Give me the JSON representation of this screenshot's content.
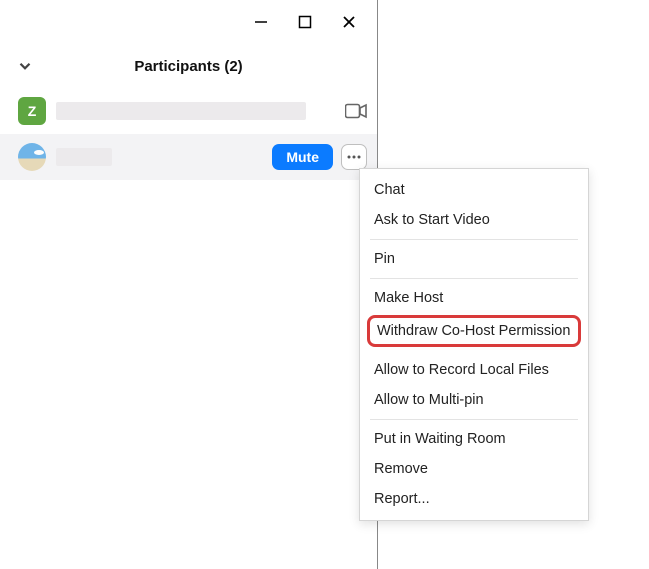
{
  "header": {
    "title": "Participants (2)"
  },
  "participants": [
    {
      "initial": "Z"
    },
    {}
  ],
  "actions": {
    "mute": "Mute"
  },
  "menu": {
    "chat": "Chat",
    "ask_video": "Ask to Start Video",
    "pin": "Pin",
    "make_host": "Make Host",
    "withdraw_cohost": "Withdraw Co-Host Permission",
    "allow_record": "Allow to Record Local Files",
    "allow_multipin": "Allow to Multi-pin",
    "waiting_room": "Put in Waiting Room",
    "remove": "Remove",
    "report": "Report..."
  }
}
